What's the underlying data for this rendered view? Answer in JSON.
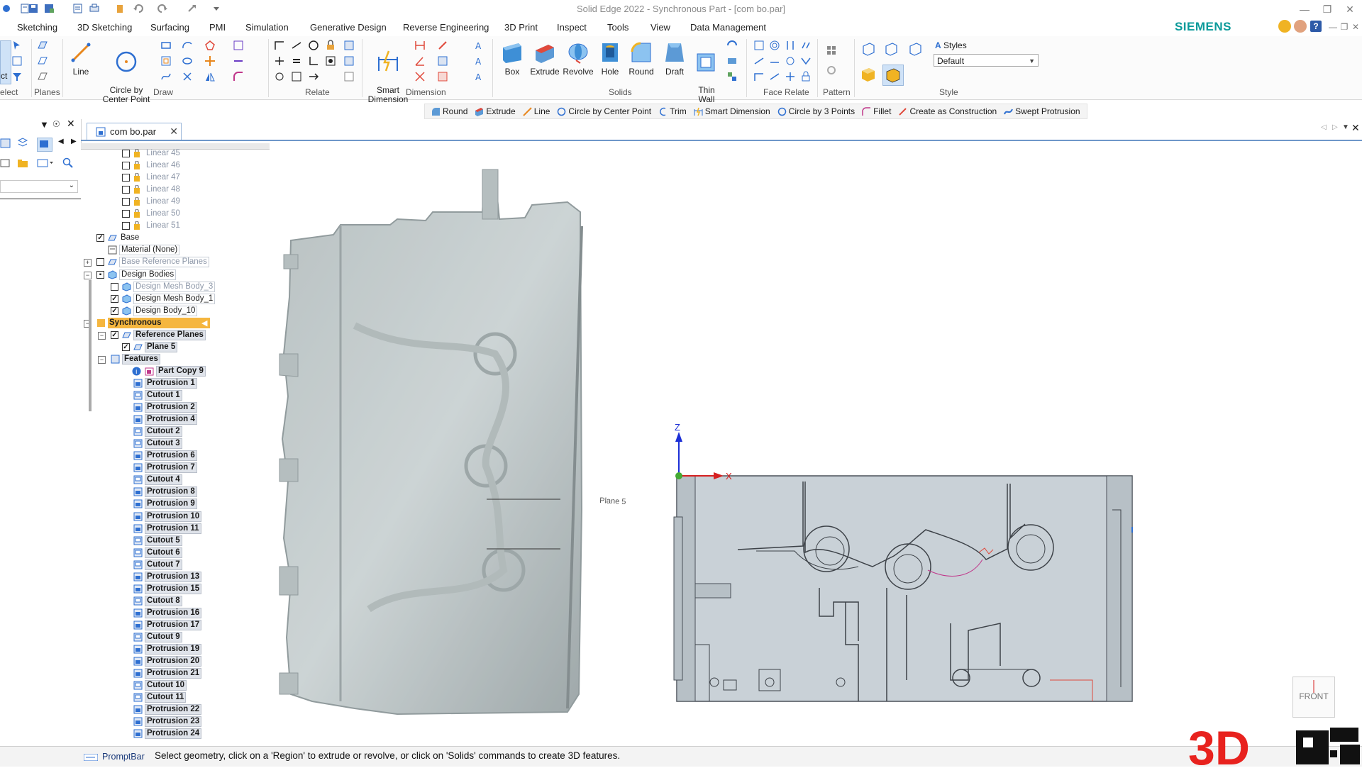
{
  "window": {
    "title": "Solid Edge 2022 - Synchronous Part - [com bo.par]",
    "controls": [
      "minimize",
      "restore",
      "close"
    ]
  },
  "ribbon": {
    "tabs": [
      "Sketching",
      "3D Sketching",
      "Surfacing",
      "PMI",
      "Simulation",
      "Generative Design",
      "Reverse Engineering",
      "3D Print",
      "Inspect",
      "Tools",
      "View",
      "Data Management"
    ],
    "brand": "SIEMENS",
    "groups": {
      "select": "elect",
      "planes": "Planes",
      "draw": "Draw",
      "relate": "Relate",
      "dimension": "Dimension",
      "solids": "Solids",
      "face_relate": "Face Relate",
      "pattern": "Pattern",
      "style": "Style"
    },
    "buttons": {
      "select_partial": "ct",
      "line": "Line",
      "circle_by_center_point": "Circle by\nCenter Point",
      "smart_dimension": "Smart\nDimension",
      "box": "Box",
      "extrude": "Extrude",
      "revolve": "Revolve",
      "hole": "Hole",
      "round": "Round",
      "draft": "Draft",
      "thin_wall": "Thin\nWall"
    },
    "styles": {
      "label": "Styles",
      "selected": "Default"
    }
  },
  "command_bar": {
    "items": [
      {
        "label": "Round",
        "icon": "round-icon"
      },
      {
        "label": "Extrude",
        "icon": "extrude-icon"
      },
      {
        "label": "Line",
        "icon": "line-icon"
      },
      {
        "label": "Circle by Center Point",
        "icon": "circle-icon"
      },
      {
        "label": "Trim",
        "icon": "trim-icon"
      },
      {
        "label": "Smart Dimension",
        "icon": "smart-dimension-icon"
      },
      {
        "label": "Circle by 3 Points",
        "icon": "circle-3pt-icon"
      },
      {
        "label": "Fillet",
        "icon": "fillet-icon"
      },
      {
        "label": "Create as Construction",
        "icon": "construction-icon"
      },
      {
        "label": "Swept Protrusion",
        "icon": "swept-protrusion-icon"
      }
    ]
  },
  "document_tab": {
    "label": "com bo.par"
  },
  "pathfinder": {
    "linear_items": [
      "Linear 45",
      "Linear 46",
      "Linear 47",
      "Linear 48",
      "Linear 49",
      "Linear 50",
      "Linear 51"
    ],
    "base": "Base",
    "material": "Material (None)",
    "base_reference_planes": "Base Reference Planes",
    "design_bodies": "Design Bodies",
    "bodies": [
      "Design Mesh Body_3",
      "Design Mesh Body_1",
      "Design Body_10"
    ],
    "synchronous": "Synchronous",
    "reference_planes": "Reference Planes",
    "plane": "Plane 5",
    "features": "Features",
    "part_copy": "Part Copy 9",
    "feature_items": [
      "Protrusion 1",
      "Cutout 1",
      "Protrusion 2",
      "Protrusion 4",
      "Cutout 2",
      "Cutout 3",
      "Protrusion 6",
      "Protrusion 7",
      "Cutout 4",
      "Protrusion 8",
      "Protrusion 9",
      "Protrusion 10",
      "Protrusion 11",
      "Cutout 5",
      "Cutout 6",
      "Cutout 7",
      "Protrusion 13",
      "Protrusion 15",
      "Cutout 8",
      "Protrusion 16",
      "Protrusion 17",
      "Cutout 9",
      "Protrusion 19",
      "Protrusion 20",
      "Protrusion 21",
      "Cutout 10",
      "Cutout 11",
      "Protrusion 22",
      "Protrusion 23",
      "Protrusion 24"
    ]
  },
  "viewport": {
    "plane_label": "Plane 5",
    "axis_z": "Z",
    "axis_x": "X",
    "view_cube": "FRONT"
  },
  "prompt_bar": {
    "tab_label": "PromptBar",
    "message": "Select geometry, click on a 'Region' to extrude or revolve, or click on 'Solids' commands to create 3D features."
  },
  "watermark": "3D",
  "colors": {
    "brand": "#0b9a9a",
    "synchronous_highlight": "#f5b63f",
    "model_fill": "#c8d0d6",
    "model_stroke": "#4a5058",
    "feature_box": "#dfe3ea"
  }
}
